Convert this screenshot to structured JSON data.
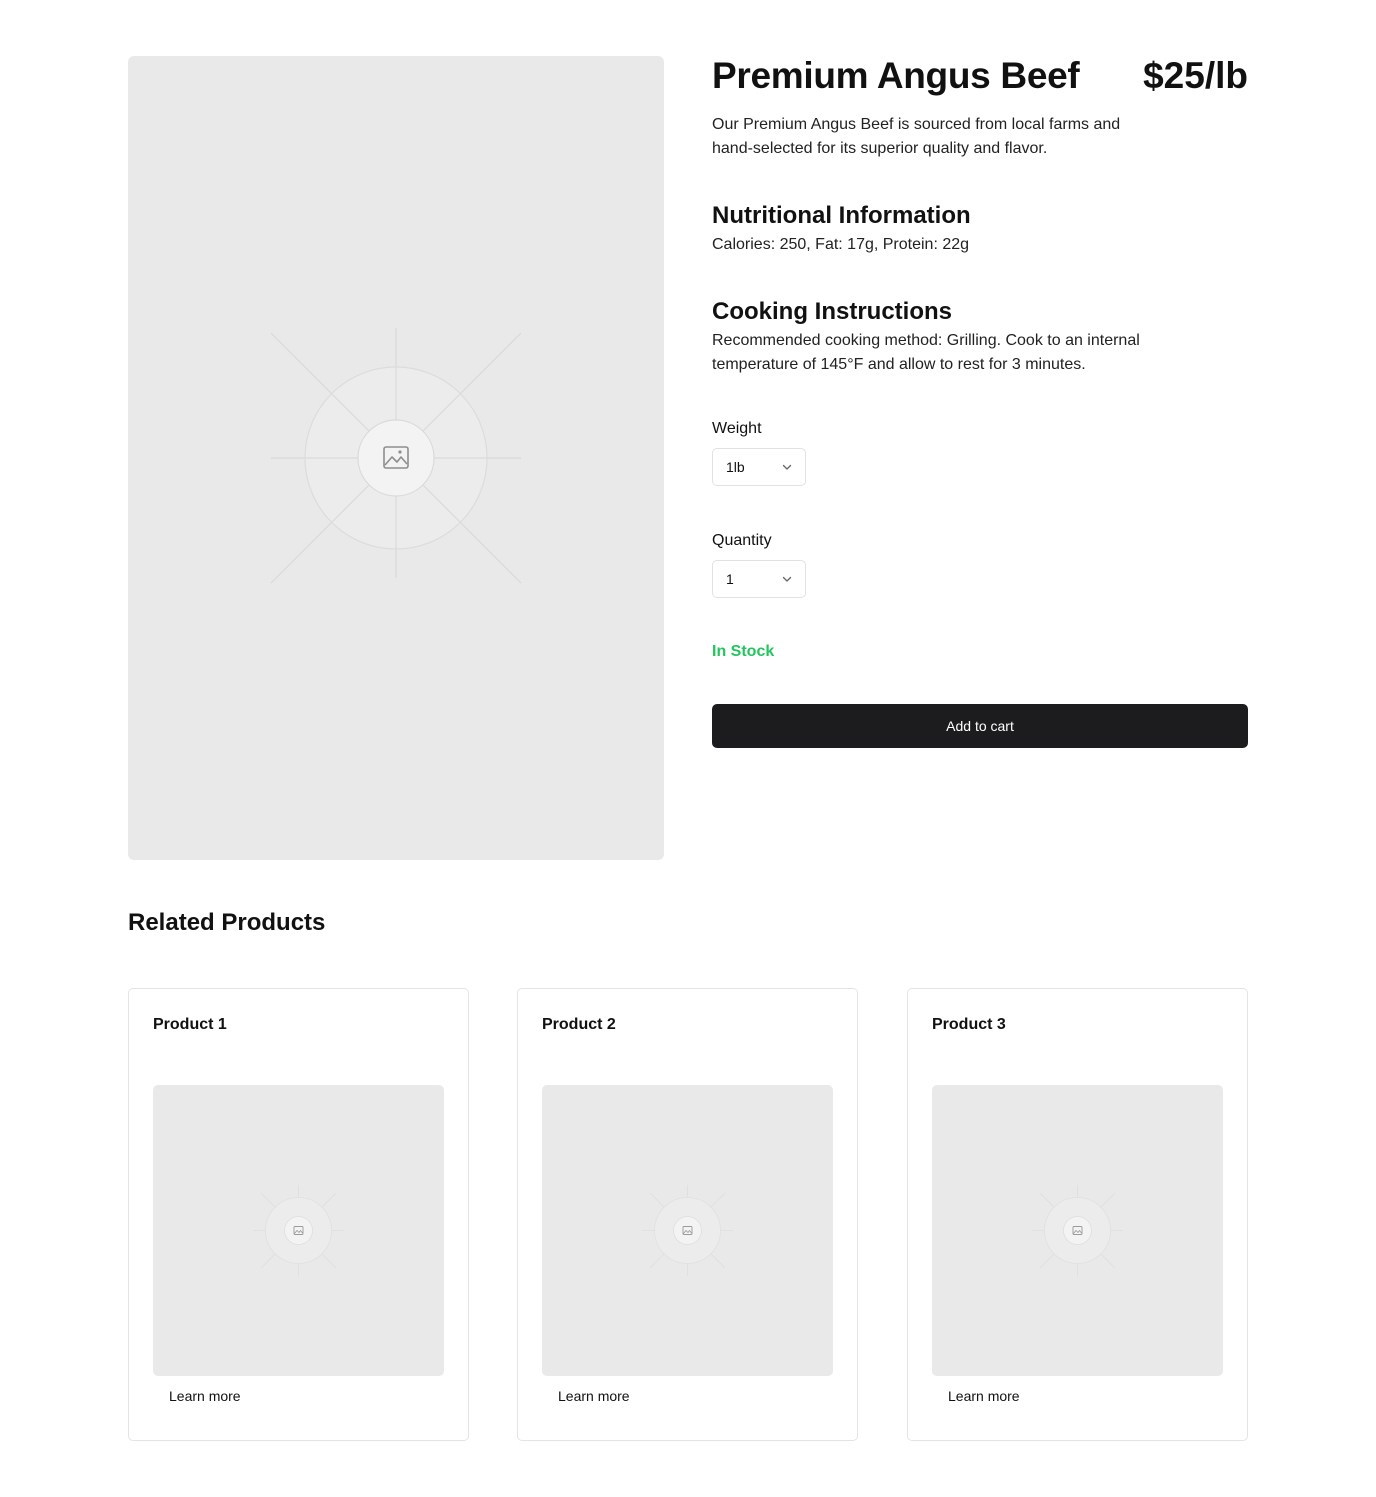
{
  "product": {
    "title": "Premium Angus Beef",
    "price": "$25/lb",
    "description": "Our Premium Angus Beef is sourced from local farms and hand-selected for its superior quality and flavor.",
    "image_icon": "image-placeholder-icon"
  },
  "nutrition": {
    "heading": "Nutritional Information",
    "text": "Calories: 250, Fat: 17g, Protein: 22g"
  },
  "cooking": {
    "heading": "Cooking Instructions",
    "text": "Recommended cooking method: Grilling. Cook to an internal temperature of 145°F and allow to rest for 3 minutes."
  },
  "weight": {
    "label": "Weight",
    "selected": "1lb",
    "icon": "chevron-down-icon"
  },
  "quantity": {
    "label": "Quantity",
    "selected": "1",
    "icon": "chevron-down-icon"
  },
  "stock": {
    "text": "In Stock",
    "color": "#22c55e"
  },
  "cart": {
    "button_label": "Add to cart",
    "color": "#1c1c1e"
  },
  "related": {
    "heading": "Related Products",
    "items": [
      {
        "title": "Product 1",
        "link": "Learn more"
      },
      {
        "title": "Product 2",
        "link": "Learn more"
      },
      {
        "title": "Product 3",
        "link": "Learn more"
      }
    ]
  }
}
